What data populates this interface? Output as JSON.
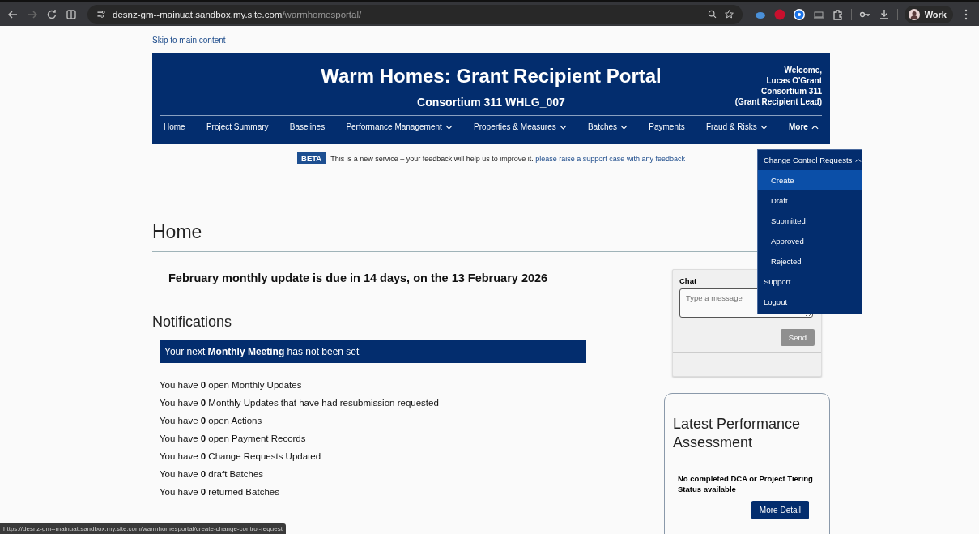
{
  "browser": {
    "url_domain": "desnz-gm--mainuat.sandbox.my.site.com",
    "url_path": "/warmhomesportal/",
    "profile": "Work",
    "status_link": "https://desnz-gm--mainuat.sandbox.my.site.com/warmhomesportal/create-change-control-request"
  },
  "skip_link": "Skip to main content",
  "header": {
    "title": "Warm Homes: Grant Recipient Portal",
    "subtitle": "Consortium 311 WHLG_007",
    "welcome": [
      "Welcome,",
      "Lucas O'Grant",
      "Consortium 311",
      "(Grant Recipient Lead)"
    ]
  },
  "nav": [
    {
      "label": "Home",
      "has_menu": false,
      "expanded": false
    },
    {
      "label": "Project Summary",
      "has_menu": false,
      "expanded": false
    },
    {
      "label": "Baselines",
      "has_menu": false,
      "expanded": false
    },
    {
      "label": "Performance Management",
      "has_menu": true,
      "expanded": false
    },
    {
      "label": "Properties & Measures",
      "has_menu": true,
      "expanded": false
    },
    {
      "label": "Batches",
      "has_menu": true,
      "expanded": false
    },
    {
      "label": "Payments",
      "has_menu": false,
      "expanded": false
    },
    {
      "label": "Fraud & Risks",
      "has_menu": true,
      "expanded": false
    },
    {
      "label": "More",
      "has_menu": true,
      "expanded": true
    }
  ],
  "more_menu": [
    {
      "label": "Change Control Requests",
      "expanded": true,
      "children": [
        {
          "label": "Create",
          "selected": true
        },
        {
          "label": "Draft",
          "selected": false
        },
        {
          "label": "Submitted",
          "selected": false
        },
        {
          "label": "Approved",
          "selected": false
        },
        {
          "label": "Rejected",
          "selected": false
        }
      ]
    },
    {
      "label": "Support"
    },
    {
      "label": "Logout"
    }
  ],
  "beta": {
    "tag": "BETA",
    "text": "This is a new service – your feedback will help us to improve it.",
    "link": "please raise a support case with any feedback"
  },
  "page_title": "Home",
  "due_notice": "February monthly update is due in 14 days, on the 13 February 2026",
  "notifications": {
    "title": "Notifications",
    "banner": "Your next **Monthly Meeting** has not been set",
    "lines": [
      "You have **0** open Monthly Updates",
      "You have **0** Monthly Updates that have had resubmission requested",
      "You have **0** open Actions",
      "You have **0** open Payment Records",
      "You have **0** Change Requests Updated",
      "You have **0** draft Batches",
      "You have **0** returned Batches"
    ]
  },
  "chat": {
    "title": "Chat",
    "placeholder": "Type a message",
    "send": "Send",
    "send_disabled": true
  },
  "performance": {
    "title": "Latest Performance Assessment",
    "status": "No completed DCA or Project Tiering Status available",
    "button": "More Detail"
  }
}
